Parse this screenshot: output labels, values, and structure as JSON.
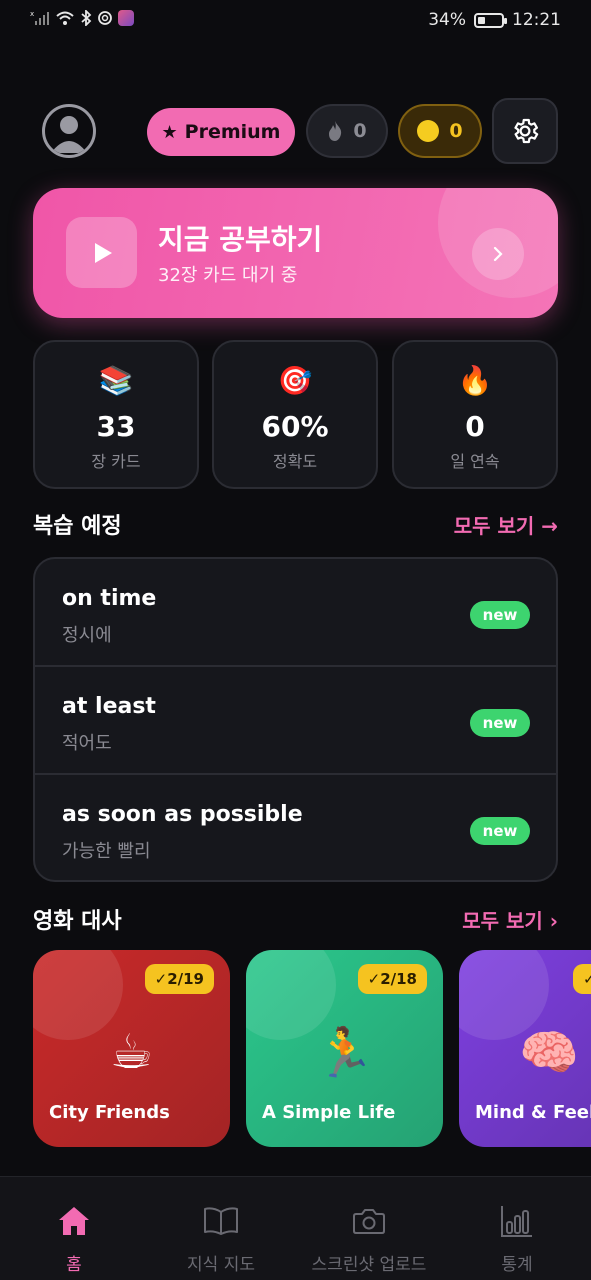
{
  "status_bar": {
    "battery": "34%",
    "battery_level": 0.34,
    "time": "12:21",
    "icons": [
      "signal-icon",
      "wifi-icon",
      "bluetooth-icon",
      "openai-icon",
      "game-app-icon"
    ]
  },
  "header": {
    "avatar_icon": "user-avatar-icon",
    "premium_label": "Premium",
    "premium_icon": "star-icon",
    "streak_count": "0",
    "coin_count": "0",
    "settings_icon": "gear-icon"
  },
  "study": {
    "title": "지금 공부하기",
    "subtitle": "32장 카드 대기 중",
    "icon": "play-icon"
  },
  "stats": [
    {
      "icon": "books-icon",
      "emoji": "📚",
      "value": "33",
      "label": "장 카드"
    },
    {
      "icon": "target-icon",
      "emoji": "🎯",
      "value": "60%",
      "label": "정확도"
    },
    {
      "icon": "fire-icon",
      "emoji": "🔥",
      "value": "0",
      "label": "일 연속"
    }
  ],
  "review": {
    "title": "복습 예정",
    "see_all": "모두 보기 →",
    "items": [
      {
        "word": "on time",
        "meaning": "정시에",
        "badge": "new"
      },
      {
        "word": "at least",
        "meaning": "적어도",
        "badge": "new"
      },
      {
        "word": "as soon as possible",
        "meaning": "가능한 빨리",
        "badge": "new"
      }
    ]
  },
  "movies": {
    "title": "영화 대사",
    "see_all": "모두 보기 ›",
    "items": [
      {
        "title": "City Friends",
        "progress": "✓2/19",
        "emoji": "☕",
        "color": "#c92a2a"
      },
      {
        "title": "A Simple Life",
        "progress": "✓2/18",
        "emoji": "🏃",
        "color": "#2bc78c"
      },
      {
        "title": "Mind & Feelings",
        "progress": "✓",
        "emoji": "🧠",
        "color": "#7e3fe0"
      }
    ]
  },
  "nav": [
    {
      "label": "홈",
      "icon": "home-icon",
      "active": true
    },
    {
      "label": "지식 지도",
      "icon": "book-icon",
      "active": false
    },
    {
      "label": "스크린샷 업로드",
      "icon": "camera-icon",
      "active": false
    },
    {
      "label": "통계",
      "icon": "bar-chart-icon",
      "active": false
    }
  ],
  "colors": {
    "accent": "#f26bb2",
    "background": "#0c0c0f",
    "card": "#16171c",
    "success": "#3dd46f",
    "coin": "#f5c320"
  }
}
